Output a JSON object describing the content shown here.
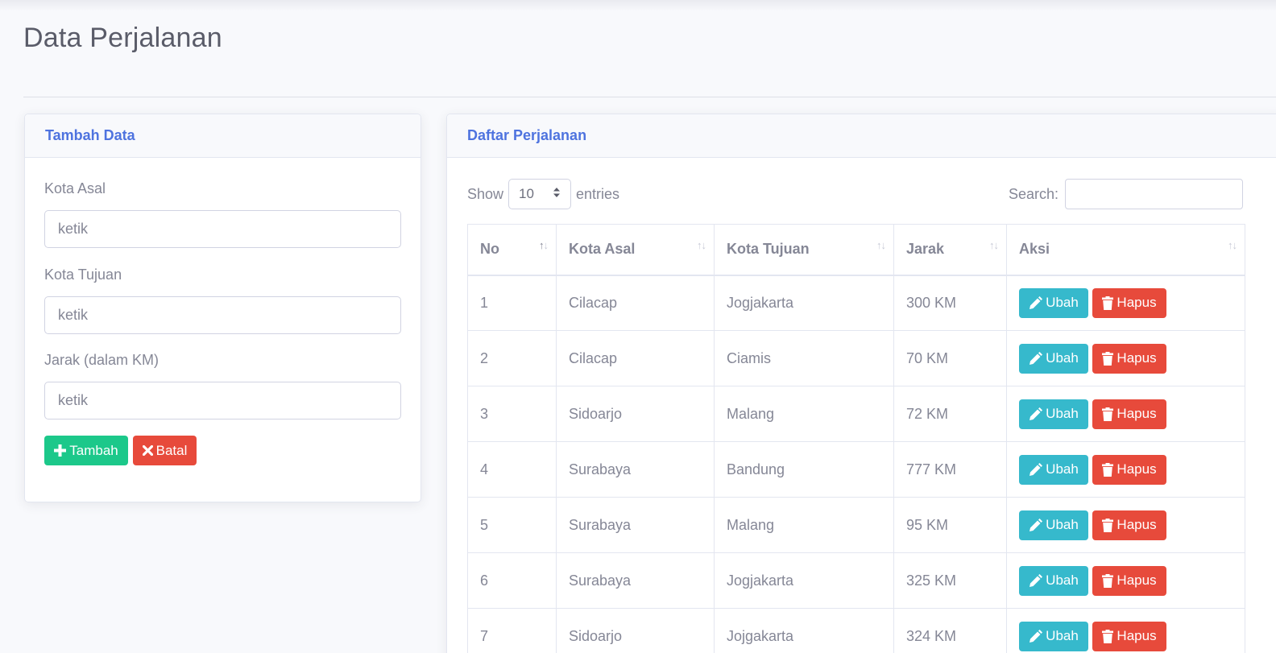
{
  "page": {
    "title": "Data Perjalanan"
  },
  "form": {
    "header": "Tambah Data",
    "fields": [
      {
        "label": "Kota Asal",
        "placeholder": "ketik"
      },
      {
        "label": "Kota Tujuan",
        "placeholder": "ketik"
      },
      {
        "label": "Jarak (dalam KM)",
        "placeholder": "ketik"
      }
    ],
    "add_label": "Tambah",
    "cancel_label": "Batal"
  },
  "list": {
    "header": "Daftar Perjalanan",
    "show_label": "Show",
    "entries_value": "10",
    "entries_label": "entries",
    "search_label": "Search:",
    "columns": [
      "No",
      "Kota Asal",
      "Kota Tujuan",
      "Jarak",
      "Aksi"
    ],
    "edit_label": "Ubah",
    "delete_label": "Hapus",
    "rows": [
      {
        "no": "1",
        "asal": "Cilacap",
        "tujuan": "Jogjakarta",
        "jarak": "300 KM"
      },
      {
        "no": "2",
        "asal": "Cilacap",
        "tujuan": "Ciamis",
        "jarak": "70 KM"
      },
      {
        "no": "3",
        "asal": "Sidoarjo",
        "tujuan": "Malang",
        "jarak": "72 KM"
      },
      {
        "no": "4",
        "asal": "Surabaya",
        "tujuan": "Bandung",
        "jarak": "777 KM"
      },
      {
        "no": "5",
        "asal": "Surabaya",
        "tujuan": "Malang",
        "jarak": "95 KM"
      },
      {
        "no": "6",
        "asal": "Surabaya",
        "tujuan": "Jogjakarta",
        "jarak": "325 KM"
      },
      {
        "no": "7",
        "asal": "Sidoarjo",
        "tujuan": "Jojgakarta",
        "jarak": "324 KM"
      }
    ]
  },
  "colors": {
    "primary": "#4e73df",
    "success": "#1cc88a",
    "danger": "#e74a3b",
    "info": "#36b9cc"
  }
}
